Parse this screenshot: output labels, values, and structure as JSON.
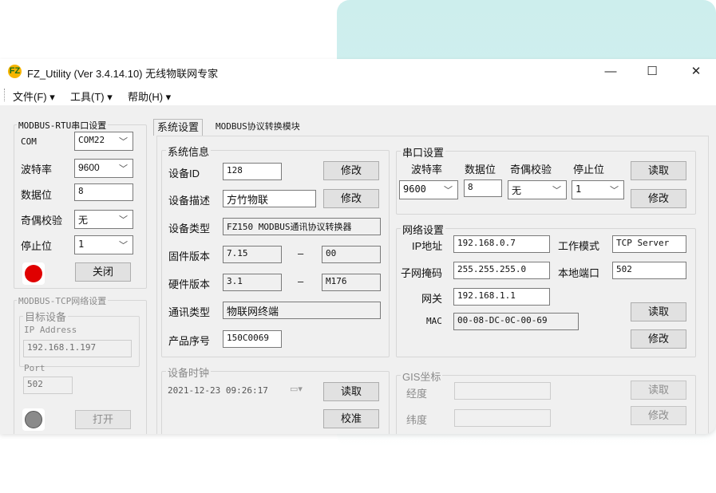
{
  "window": {
    "title": "FZ_Utility (Ver 3.4.14.10) 无线物联网专家",
    "logo_text": "FZ",
    "minimize": "—",
    "maximize": "☐",
    "close": "✕"
  },
  "menu": [
    {
      "label": "文件(F) ▾"
    },
    {
      "label": "工具(T) ▾"
    },
    {
      "label": "帮助(H) ▾"
    }
  ],
  "left_panel": {
    "serial_group_title": "MODBUS-RTU串口设置",
    "com_label": "COM",
    "com_value": "COM22",
    "baud_label": "波特率",
    "baud_value": "9600",
    "databits_label": "数据位",
    "databits_value": "8",
    "parity_label": "奇偶校验",
    "parity_value": "无",
    "stopbits_label": "停止位",
    "stopbits_value": "1",
    "close_button": "关闭",
    "tcp_group_title": "MODBUS-TCP网络设置",
    "target_group_title": "目标设备",
    "ip_label": "IP Address",
    "ip_value": "192.168.1.197",
    "port_label": "Port",
    "port_value": "502",
    "open_button": "打开",
    "status_red": "#e00000",
    "status_gray": "#8a8a8a"
  },
  "tabs": [
    {
      "label": "系统设置"
    },
    {
      "label": "MODBUS协议转换模块"
    }
  ],
  "system_info": {
    "title": "系统信息",
    "device_id_label": "设备ID",
    "device_id_value": "128",
    "modify1": "修改",
    "desc_label": "设备描述",
    "desc_value": "方竹物联",
    "modify2": "修改",
    "type_label": "设备类型",
    "type_value": "FZ150 MODBUS通讯协议转换器",
    "fw_label": "固件版本",
    "fw_major": "7.15",
    "fw_dash": "–",
    "fw_minor": "00",
    "hw_label": "硬件版本",
    "hw_major": "3.1",
    "hw_dash": "–",
    "hw_minor": "M176",
    "comm_label": "通讯类型",
    "comm_value": "物联网终端",
    "serial_label": "产品序号",
    "serial_value": "150C0069"
  },
  "device_clock": {
    "title": "设备时钟",
    "value": "2021-12-23 09:26:17",
    "read_button": "读取",
    "calibrate_button": "校准"
  },
  "serial_settings": {
    "title": "串口设置",
    "headers": [
      "波特率",
      "数据位",
      "奇偶校验",
      "停止位"
    ],
    "baud": "9600",
    "databits": "8",
    "parity": "无",
    "stopbits": "1",
    "read_button": "读取",
    "modify_button": "修改"
  },
  "network_settings": {
    "title": "网络设置",
    "ip_label": "IP地址",
    "ip_value": "192.168.0.7",
    "mode_label": "工作模式",
    "mode_value": "TCP Server",
    "mask_label": "子网掩码",
    "mask_value": "255.255.255.0",
    "port_label": "本地端口",
    "port_value": "502",
    "gateway_label": "网关",
    "gateway_value": "192.168.1.1",
    "mac_label": "MAC",
    "mac_value": "00-08-DC-0C-00-69",
    "read_button": "读取",
    "modify_button": "修改"
  },
  "gis": {
    "title": "GIS坐标",
    "lng_label": "经度",
    "lat_label": "纬度",
    "lng_value": "",
    "lat_value": "",
    "read_button": "读取",
    "modify_button": "修改"
  }
}
